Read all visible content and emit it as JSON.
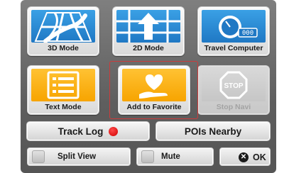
{
  "tiles": [
    {
      "label": "3D Mode",
      "icon": "3d-map-icon"
    },
    {
      "label": "2D Mode",
      "icon": "2d-map-icon"
    },
    {
      "label": "Travel Computer",
      "icon": "speedometer-icon",
      "odometer": "000"
    },
    {
      "label": "Text Mode",
      "icon": "text-list-icon"
    },
    {
      "label": "Add to Favorite",
      "icon": "heart-hand-icon"
    },
    {
      "label": "Stop Navi",
      "icon": "stop-sign-icon",
      "sign_text": "STOP",
      "state": "disabled"
    }
  ],
  "bars": {
    "track_log": "Track Log",
    "pois_nearby": "POIs Nearby"
  },
  "buttons": {
    "split_view": "Split View",
    "mute": "Mute",
    "ok": "OK"
  },
  "colors": {
    "blue_tile": "#1f78c4",
    "orange_tile": "#f7a400",
    "highlight_border": "#cc3b3b",
    "record_dot": "#d00000"
  }
}
